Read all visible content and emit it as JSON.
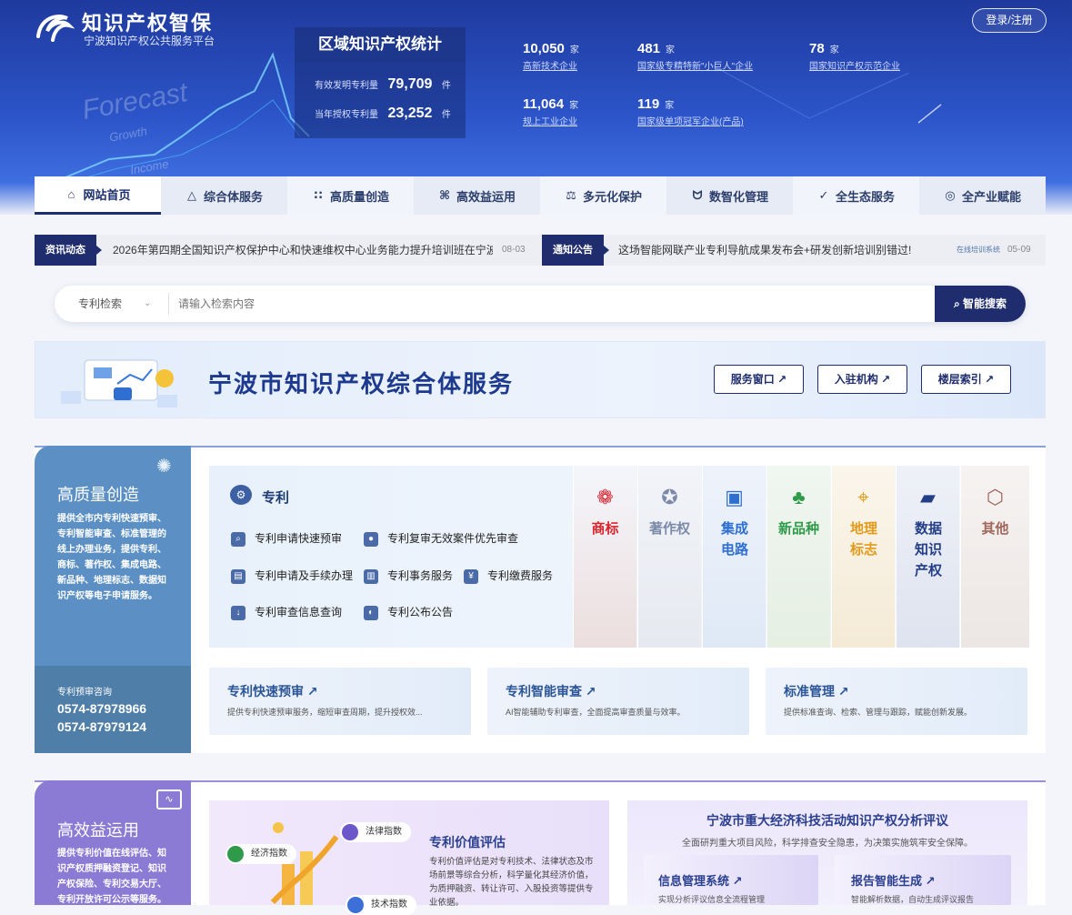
{
  "header": {
    "logo_title": "知识产权智保",
    "logo_subtitle": "宁波知识产权公共服务平台",
    "login": "登录/注册",
    "deco_texts": [
      "Forecast",
      "Growth",
      "Income"
    ]
  },
  "stats_box": {
    "title": "区域知识产权统计",
    "rows": [
      {
        "label": "有效发明专利量",
        "value": "79,709",
        "unit": "件"
      },
      {
        "label": "当年授权专利量",
        "value": "23,252",
        "unit": "件"
      }
    ]
  },
  "header_stats": [
    {
      "value": "10,050",
      "unit": "家",
      "label": "高新技术企业"
    },
    {
      "value": "481",
      "unit": "家",
      "label": "国家级专精特新\"小巨人\"企业"
    },
    {
      "value": "78",
      "unit": "家",
      "label": "国家知识产权示范企业"
    },
    {
      "value": "11,064",
      "unit": "家",
      "label": "规上工业企业"
    },
    {
      "value": "119",
      "unit": "家",
      "label": "国家级单项冠军企业(产品)"
    }
  ],
  "nav": [
    {
      "label": "网站首页",
      "icon": "home-icon",
      "glyph": "⌂"
    },
    {
      "label": "综合体服务",
      "icon": "warning-triangle-icon",
      "glyph": "△"
    },
    {
      "label": "高质量创造",
      "icon": "grid-icon",
      "glyph": "∷"
    },
    {
      "label": "高效益运用",
      "icon": "command-icon",
      "glyph": "⌘"
    },
    {
      "label": "多元化保护",
      "icon": "scale-icon",
      "glyph": "⚖"
    },
    {
      "label": "数智化管理",
      "icon": "bulb-icon",
      "glyph": "ᗢ"
    },
    {
      "label": "全生态服务",
      "icon": "check-circle-icon",
      "glyph": "✓"
    },
    {
      "label": "全产业赋能",
      "icon": "target-icon",
      "glyph": "◎"
    }
  ],
  "news": {
    "tag1": "资讯动态",
    "text1": "2026年第四期全国知识产权保护中心和快速维权中心业务能力提升培训班在宁波...",
    "date1": "08-03",
    "tag2": "通知公告",
    "text2": "这场智能网联产业专利导航成果发布会+研发创新培训别错过!",
    "source2": "在线培训系统",
    "date2": "05-09"
  },
  "search": {
    "type": "专利检索",
    "placeholder": "请输入检索内容",
    "button": "智能搜索"
  },
  "banner": {
    "title": "宁波市知识产权综合体服务",
    "buttons": [
      "服务窗口 ↗",
      "入驻机构 ↗",
      "楼层索引 ↗"
    ]
  },
  "section1": {
    "title": "高质量创造",
    "desc": "提供全市内专利快速预审、专利智能审查、标准管理的线上办理业务，提供专利、商标、著作权、集成电路、新品种、地理标志、数据知识产权等电子申请服务。",
    "contact_label": "专利预审咨询",
    "phones": [
      "0574-87978966",
      "0574-87979124"
    ],
    "panel_title": "专利",
    "services": [
      "专利申请快速预审",
      "专利复审无效案件优先审查",
      "专利申请及手续办理",
      "专利事务服务",
      "专利缴费服务",
      "专利审查信息查询",
      "专利公布公告"
    ],
    "columns": [
      {
        "label": "商标",
        "color": "#d8242f",
        "icon": "award-icon",
        "glyph": "🎖"
      },
      {
        "label": "著作权",
        "color": "#7a8aa8",
        "icon": "copyright-icon",
        "glyph": "✪"
      },
      {
        "label": "集成电路",
        "color": "#2f6fd1",
        "icon": "chip-icon",
        "glyph": "▣"
      },
      {
        "label": "新品种",
        "color": "#2f9b4a",
        "icon": "plant-icon",
        "glyph": "♣"
      },
      {
        "label": "地理标志",
        "color": "#e39a18",
        "icon": "map-pin-icon",
        "glyph": "⌖"
      },
      {
        "label": "数据知识产权",
        "color": "#223e86",
        "icon": "data-chart-icon",
        "glyph": "📈"
      },
      {
        "label": "其他",
        "color": "#a0675a",
        "icon": "hexagon-icon",
        "glyph": "⬡"
      }
    ],
    "cards": [
      {
        "title": "专利快速预审 ↗",
        "desc": "提供专利快速预审服务，缩短审查周期，提升授权效..."
      },
      {
        "title": "专利智能审查 ↗",
        "desc": "AI智能辅助专利审查，全面提高审查质量与效率。"
      },
      {
        "title": "标准管理 ↗",
        "desc": "提供标准查询、检索、管理与跟踪，赋能创新发展。"
      }
    ]
  },
  "section2": {
    "title": "高效益运用",
    "desc": "提供专利价值在线评估、知识产权质押融资登记、知识产权保险、专利交易大厅、专利开放许可公示等服务。",
    "chips": [
      "法律指数",
      "经济指数",
      "技术指数"
    ],
    "panel_a_title": "专利价值评估",
    "panel_a_desc": "专利价值评估是对专利技术、法律状态及市场前景等综合分析，科学量化其经济价值，为质押融资、转让许可、入股投资等提供专业依据。",
    "panel_b_title": "宁波市重大经济科技活动知识产权分析评议",
    "panel_b_sub": "全面研判重大项目风险，科学排查安全隐患，为决策实施筑牢安全保障。",
    "panel_b_cards": [
      {
        "title": "信息管理系统 ↗",
        "desc": "实现分析评议信息全流程管理"
      },
      {
        "title": "报告智能生成 ↗",
        "desc": "智能解析数据，自动生成评议报告"
      }
    ]
  }
}
